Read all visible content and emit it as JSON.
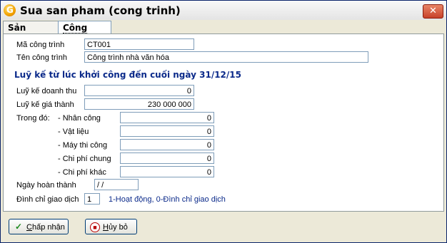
{
  "window": {
    "title": "Sua san pham (cong trinh)",
    "app_icon_letter": "G",
    "close_glyph": "✕"
  },
  "tabs": [
    {
      "label": "Sản phẩm"
    },
    {
      "label": "Công trình",
      "active": true
    }
  ],
  "form": {
    "ma_label": "Mã công trình",
    "ma_value": "CT001",
    "ten_label": "Tên công trình",
    "ten_value": "Công trình nhà văn hóa",
    "heading": "Luỹ kế từ lúc khởi công đến cuối ngày 31/12/15",
    "doanh_thu_label": "Luỹ kế doanh thu",
    "doanh_thu_value": "0",
    "gia_thanh_label": "Luỹ kế giá thành",
    "gia_thanh_value": "230 000 000",
    "trong_do_label": "Trong đó:",
    "components": [
      {
        "label": "- Nhân công",
        "value": "0"
      },
      {
        "label": "- Vật liệu",
        "value": "0"
      },
      {
        "label": "- Máy thi công",
        "value": "0"
      },
      {
        "label": "- Chi phí chung",
        "value": "0"
      },
      {
        "label": "- Chi phí khác",
        "value": "0"
      }
    ],
    "hoan_thanh_label": "Ngày hoàn thành",
    "hoan_thanh_value": " /  /",
    "dinh_chi_label": "Đình chỉ giao dịch",
    "dinh_chi_value": "1",
    "dinh_chi_hint": "1-Hoạt động, 0-Đình chỉ giao dịch"
  },
  "buttons": {
    "ok_mnemonic": "C",
    "ok_rest": "hấp nhận",
    "cancel_mnemonic": "H",
    "cancel_rest": "ủy bỏ"
  },
  "colors": {
    "heading": "#0b2a8a",
    "close_button": "#c7412a",
    "tab_border": "#919b9c"
  },
  "icons": {
    "ok": "check-icon",
    "cancel": "stop-icon",
    "app": "app-logo-icon",
    "close": "close-icon"
  }
}
